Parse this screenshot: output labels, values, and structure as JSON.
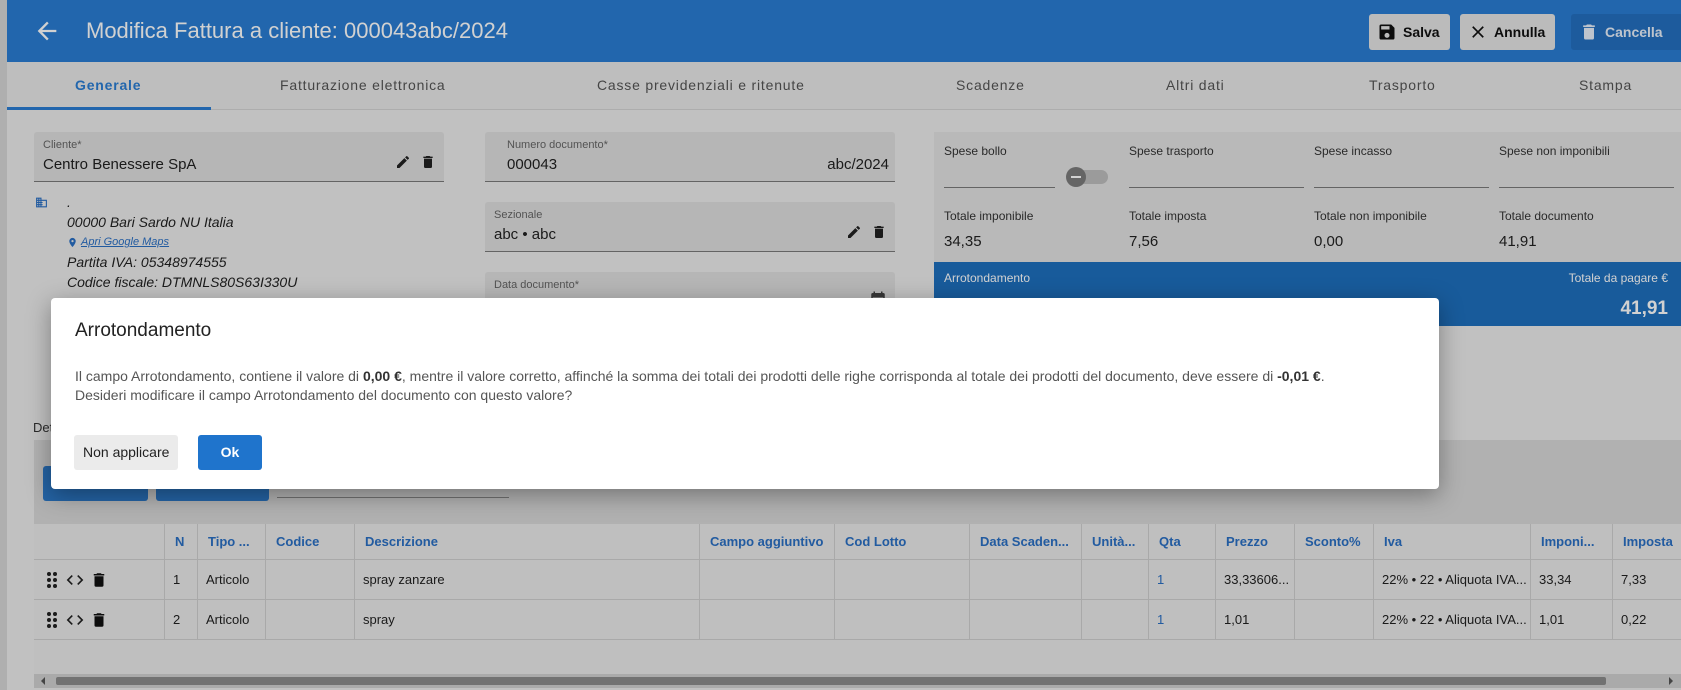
{
  "header": {
    "title": "Modifica Fattura a cliente: 000043abc/2024",
    "save_label": "Salva",
    "cancel_label": "Annulla",
    "delete_label": "Cancella"
  },
  "tabs": [
    {
      "label": "Generale"
    },
    {
      "label": "Fatturazione elettronica"
    },
    {
      "label": "Casse previdenziali e ritenute"
    },
    {
      "label": "Scadenze"
    },
    {
      "label": "Altri dati"
    },
    {
      "label": "Trasporto"
    },
    {
      "label": "Stampa"
    }
  ],
  "form": {
    "cliente_label": "Cliente*",
    "cliente_value": "Centro Benessere SpA",
    "address_dot": ".",
    "address_line": "00000 Bari Sardo NU Italia",
    "maps_link": "Apri Google Maps",
    "partita_iva": "Partita IVA: 05348974555",
    "codice_fiscale": "Codice fiscale: DTMNLS80S63I330U",
    "numero_label": "Numero documento*",
    "numero_value": "000043",
    "numero_suffix": "abc/2024",
    "sezionale_label": "Sezionale",
    "sezionale_value": "abc • abc",
    "data_label": "Data documento*"
  },
  "totals": {
    "spese_bollo": "Spese bollo",
    "spese_trasporto": "Spese trasporto",
    "spese_incasso": "Spese incasso",
    "spese_non_imponibili": "Spese non imponibili",
    "totale_imponibile_label": "Totale imponibile",
    "totale_imponibile": "34,35",
    "totale_imposta_label": "Totale imposta",
    "totale_imposta": "7,56",
    "totale_non_imponibile_label": "Totale non imponibile",
    "totale_non_imponibile": "0,00",
    "totale_documento_label": "Totale documento",
    "totale_documento": "41,91",
    "arrotondamento_label": "Arrotondamento",
    "totale_pagare_label": "Totale da pagare €",
    "totale_pagare": "41,91"
  },
  "details": {
    "label": "Det"
  },
  "table": {
    "headers": [
      "N",
      "Tipo ...",
      "Codice",
      "Descrizione",
      "Campo aggiuntivo",
      "Cod Lotto",
      "Data Scaden...",
      "Unità...",
      "Qta",
      "Prezzo",
      "Sconto%",
      "Iva",
      "Imponi...",
      "Imposta"
    ],
    "rows": [
      {
        "n": "1",
        "tipo": "Articolo",
        "codice": "",
        "descrizione": "spray zanzare",
        "campo": "",
        "lotto": "",
        "data": "",
        "unita": "",
        "qta": "1",
        "prezzo": "33,33606...",
        "sconto": "",
        "iva": "22% • 22 • Aliquota IVA...",
        "imponibile": "33,34",
        "imposta": "7,33"
      },
      {
        "n": "2",
        "tipo": "Articolo",
        "codice": "",
        "descrizione": "spray",
        "campo": "",
        "lotto": "",
        "data": "",
        "unita": "",
        "qta": "1",
        "prezzo": "1,01",
        "sconto": "",
        "iva": "22% • 22 • Aliquota IVA...",
        "imponibile": "1,01",
        "imposta": "0,22"
      }
    ]
  },
  "dialog": {
    "title": "Arrotondamento",
    "msg_part1": "Il campo Arrotondamento, contiene il valore di ",
    "msg_value_current": "0,00 €",
    "msg_part2": ", mentre il valore corretto, affinché la somma dei totali dei prodotti delle righe corrisponda al totale dei prodotti del documento, deve essere di ",
    "msg_value_correct": "-0,01 €",
    "msg_part3": ".",
    "msg_line2": "Desideri modificare il campo Arrotondamento del documento con questo valore?",
    "no_label": "Non applicare",
    "ok_label": "Ok"
  },
  "colors": {
    "primary": "#2a7dd3",
    "totals_blue": "#1e6fbe",
    "link_blue": "#2a6fc4"
  },
  "icons": [
    "arrow-left-icon",
    "save-icon",
    "close-icon",
    "trash-icon",
    "pencil-icon",
    "company-icon",
    "map-pin-icon",
    "calendar-icon",
    "drag-handle-icon",
    "code-icon"
  ]
}
